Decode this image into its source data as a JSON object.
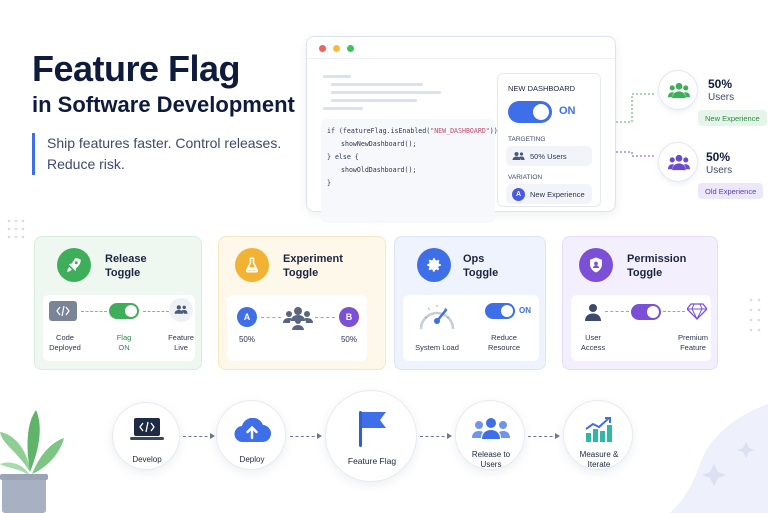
{
  "hero": {
    "title": "Feature Flag",
    "subtitle": "in Software Development",
    "tagline_line1": "Ship features faster. Control releases.",
    "tagline_line2": "Reduce risk."
  },
  "browser": {
    "code": {
      "line1_prefix": "if (featureFlag.isEnabled(",
      "line1_string": "\"NEW_DASHBOARD\"",
      "line1_suffix": ")) {",
      "line2": "showNewDashboard();",
      "line3": "} else {",
      "line4": "showOldDashboard();",
      "line5": "}"
    },
    "panel": {
      "flag_name": "NEW DASHBOARD",
      "toggle_state": "ON",
      "targeting_label": "TARGETING",
      "targeting_value": "50% Users",
      "variation_label": "VARIATION",
      "variation_badge": "A",
      "variation_value": "New Experience"
    },
    "dot_colors": [
      "#f0625a",
      "#f5bd3a",
      "#3fc35a"
    ]
  },
  "user_groups": [
    {
      "percent": "50%",
      "users": "Users",
      "tag": "New Experience",
      "icon": "users-icon-green"
    },
    {
      "percent": "50%",
      "users": "Users",
      "tag": "Old Experience",
      "icon": "users-icon-purple"
    }
  ],
  "cards": {
    "release": {
      "title_line1": "Release",
      "title_line2": "Toggle",
      "left_label_line1": "Code",
      "left_label_line2": "Deployed",
      "middle_label_line1": "Flag",
      "middle_label_line2": "ON",
      "right_label_line1": "Feature",
      "right_label_line2": "Live",
      "accent": "#3fae5a"
    },
    "experiment": {
      "title_line1": "Experiment",
      "title_line2": "Toggle",
      "variant_a": "A",
      "variant_b": "B",
      "split_a": "50%",
      "split_b": "50%",
      "accent": "#f2b233"
    },
    "ops": {
      "title_line1": "Ops",
      "title_line2": "Toggle",
      "gauge_label": "System Load",
      "switch_state": "ON",
      "action_line1": "Reduce",
      "action_line2": "Resource",
      "accent": "#3f6fe8"
    },
    "permission": {
      "title_line1": "Permission",
      "title_line2": "Toggle",
      "left_label_line1": "User",
      "left_label_line2": "Access",
      "right_label_line1": "Premium",
      "right_label_line2": "Feature",
      "accent": "#7b4fd6"
    }
  },
  "pipeline": {
    "steps": [
      {
        "label_line1": "Develop",
        "label_line2": ""
      },
      {
        "label_line1": "Deploy",
        "label_line2": ""
      },
      {
        "label_line1": "Feature Flag",
        "label_line2": ""
      },
      {
        "label_line1": "Release to",
        "label_line2": "Users"
      },
      {
        "label_line1": "Measure &",
        "label_line2": "Iterate"
      }
    ]
  },
  "colors": {
    "primary_blue": "#3f6fe8",
    "navy_text": "#0f1b3d",
    "green": "#3fae5a",
    "yellow": "#f2b233",
    "purple": "#7b4fd6"
  }
}
